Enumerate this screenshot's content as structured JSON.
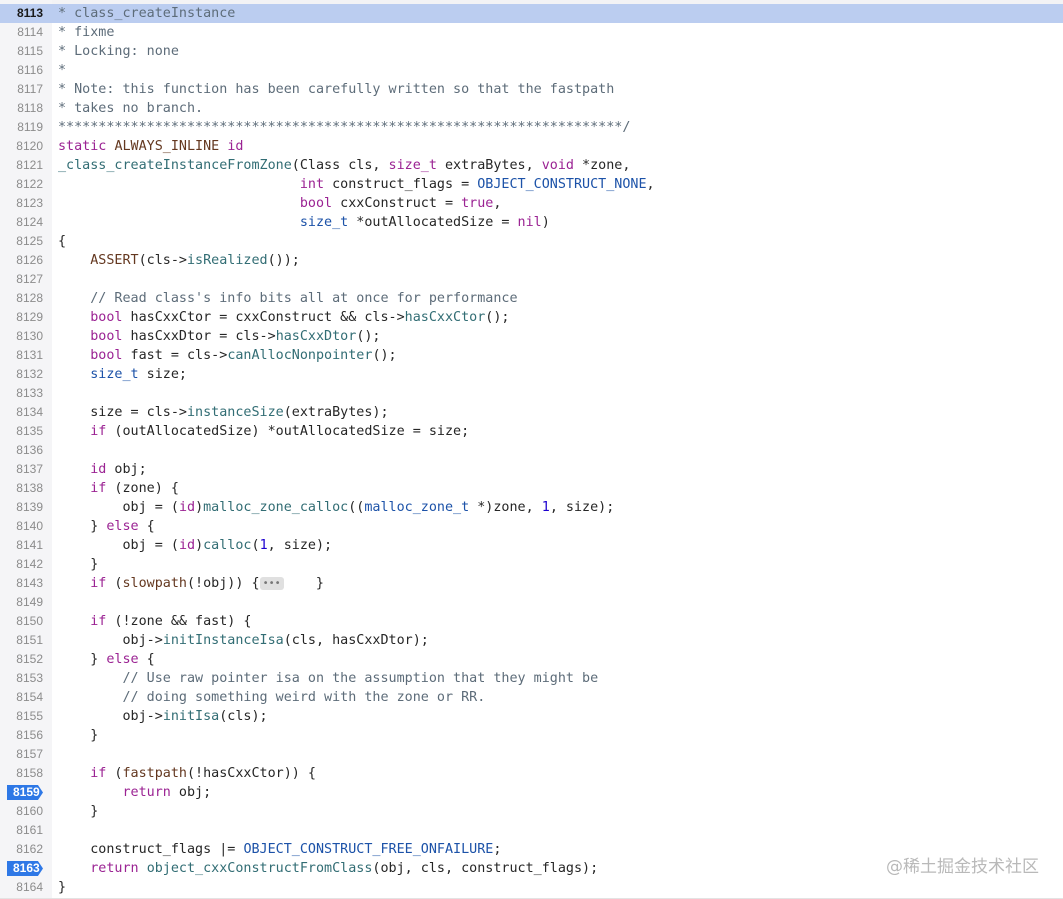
{
  "editor": {
    "current_line": "8113",
    "breakpoints": [
      "8159",
      "8163"
    ],
    "lines": [
      {
        "n": "8113",
        "t": [
          [
            "c",
            "* class_createInstance"
          ]
        ]
      },
      {
        "n": "8114",
        "t": [
          [
            "c",
            "* fixme"
          ]
        ]
      },
      {
        "n": "8115",
        "t": [
          [
            "c",
            "* Locking: none"
          ]
        ]
      },
      {
        "n": "8116",
        "t": [
          [
            "c",
            "*"
          ]
        ]
      },
      {
        "n": "8117",
        "t": [
          [
            "c",
            "* Note: this function has been carefully written so that the fastpath"
          ]
        ]
      },
      {
        "n": "8118",
        "t": [
          [
            "c",
            "* takes no branch."
          ]
        ]
      },
      {
        "n": "8119",
        "t": [
          [
            "c",
            "**********************************************************************/"
          ]
        ]
      },
      {
        "n": "8120",
        "t": [
          [
            "k",
            "static"
          ],
          [
            "p",
            " "
          ],
          [
            "m",
            "ALWAYS_INLINE"
          ],
          [
            "p",
            " "
          ],
          [
            "k",
            "id"
          ]
        ]
      },
      {
        "n": "8121",
        "t": [
          [
            "f",
            "_class_createInstanceFromZone"
          ],
          [
            "p",
            "(Class cls, "
          ],
          [
            "k",
            "size_t"
          ],
          [
            "p",
            " extraBytes, "
          ],
          [
            "k",
            "void"
          ],
          [
            "p",
            " *zone,"
          ]
        ]
      },
      {
        "n": "8122",
        "t": [
          [
            "p",
            "                              "
          ],
          [
            "k",
            "int"
          ],
          [
            "p",
            " construct_flags = "
          ],
          [
            "n",
            "OBJECT_CONSTRUCT_NONE"
          ],
          [
            "p",
            ","
          ]
        ]
      },
      {
        "n": "8123",
        "t": [
          [
            "p",
            "                              "
          ],
          [
            "k",
            "bool"
          ],
          [
            "p",
            " cxxConstruct = "
          ],
          [
            "k",
            "true"
          ],
          [
            "p",
            ","
          ]
        ]
      },
      {
        "n": "8124",
        "t": [
          [
            "p",
            "                              "
          ],
          [
            "y",
            "size_t"
          ],
          [
            "p",
            " *outAllocatedSize = "
          ],
          [
            "k",
            "nil"
          ],
          [
            "p",
            ")"
          ]
        ]
      },
      {
        "n": "8125",
        "t": [
          [
            "p",
            "{"
          ]
        ]
      },
      {
        "n": "8126",
        "t": [
          [
            "p",
            "    "
          ],
          [
            "m",
            "ASSERT"
          ],
          [
            "p",
            "(cls->"
          ],
          [
            "f",
            "isRealized"
          ],
          [
            "p",
            "());"
          ]
        ]
      },
      {
        "n": "8127",
        "t": []
      },
      {
        "n": "8128",
        "t": [
          [
            "p",
            "    "
          ],
          [
            "c",
            "// Read class's info bits all at once for performance"
          ]
        ]
      },
      {
        "n": "8129",
        "t": [
          [
            "p",
            "    "
          ],
          [
            "k",
            "bool"
          ],
          [
            "p",
            " hasCxxCtor = cxxConstruct && cls->"
          ],
          [
            "f",
            "hasCxxCtor"
          ],
          [
            "p",
            "();"
          ]
        ]
      },
      {
        "n": "8130",
        "t": [
          [
            "p",
            "    "
          ],
          [
            "k",
            "bool"
          ],
          [
            "p",
            " hasCxxDtor = cls->"
          ],
          [
            "f",
            "hasCxxDtor"
          ],
          [
            "p",
            "();"
          ]
        ]
      },
      {
        "n": "8131",
        "t": [
          [
            "p",
            "    "
          ],
          [
            "k",
            "bool"
          ],
          [
            "p",
            " fast = cls->"
          ],
          [
            "f",
            "canAllocNonpointer"
          ],
          [
            "p",
            "();"
          ]
        ]
      },
      {
        "n": "8132",
        "t": [
          [
            "p",
            "    "
          ],
          [
            "y",
            "size_t"
          ],
          [
            "p",
            " size;"
          ]
        ]
      },
      {
        "n": "8133",
        "t": []
      },
      {
        "n": "8134",
        "t": [
          [
            "p",
            "    size = cls->"
          ],
          [
            "f",
            "instanceSize"
          ],
          [
            "p",
            "(extraBytes);"
          ]
        ]
      },
      {
        "n": "8135",
        "t": [
          [
            "p",
            "    "
          ],
          [
            "k",
            "if"
          ],
          [
            "p",
            " (outAllocatedSize) *outAllocatedSize = size;"
          ]
        ]
      },
      {
        "n": "8136",
        "t": []
      },
      {
        "n": "8137",
        "t": [
          [
            "p",
            "    "
          ],
          [
            "k",
            "id"
          ],
          [
            "p",
            " obj;"
          ]
        ]
      },
      {
        "n": "8138",
        "t": [
          [
            "p",
            "    "
          ],
          [
            "k",
            "if"
          ],
          [
            "p",
            " (zone) {"
          ]
        ]
      },
      {
        "n": "8139",
        "t": [
          [
            "p",
            "        obj = ("
          ],
          [
            "k",
            "id"
          ],
          [
            "p",
            ")"
          ],
          [
            "f",
            "malloc_zone_calloc"
          ],
          [
            "p",
            "(("
          ],
          [
            "y",
            "malloc_zone_t"
          ],
          [
            "p",
            " *)zone, "
          ],
          [
            "u",
            "1"
          ],
          [
            "p",
            ", size);"
          ]
        ]
      },
      {
        "n": "8140",
        "t": [
          [
            "p",
            "    } "
          ],
          [
            "k",
            "else"
          ],
          [
            "p",
            " {"
          ]
        ]
      },
      {
        "n": "8141",
        "t": [
          [
            "p",
            "        obj = ("
          ],
          [
            "k",
            "id"
          ],
          [
            "p",
            ")"
          ],
          [
            "f",
            "calloc"
          ],
          [
            "p",
            "("
          ],
          [
            "u",
            "1"
          ],
          [
            "p",
            ", size);"
          ]
        ]
      },
      {
        "n": "8142",
        "t": [
          [
            "p",
            "    }"
          ]
        ]
      },
      {
        "n": "8143",
        "t": [
          [
            "p",
            "    "
          ],
          [
            "k",
            "if"
          ],
          [
            "p",
            " ("
          ],
          [
            "m",
            "slowpath"
          ],
          [
            "p",
            "(!obj)) {"
          ],
          [
            "fold",
            "•••"
          ],
          [
            "p",
            "    }"
          ]
        ]
      },
      {
        "n": "8149",
        "t": []
      },
      {
        "n": "8150",
        "t": [
          [
            "p",
            "    "
          ],
          [
            "k",
            "if"
          ],
          [
            "p",
            " (!zone && fast) {"
          ]
        ]
      },
      {
        "n": "8151",
        "t": [
          [
            "p",
            "        obj->"
          ],
          [
            "f",
            "initInstanceIsa"
          ],
          [
            "p",
            "(cls, hasCxxDtor);"
          ]
        ]
      },
      {
        "n": "8152",
        "t": [
          [
            "p",
            "    } "
          ],
          [
            "k",
            "else"
          ],
          [
            "p",
            " {"
          ]
        ]
      },
      {
        "n": "8153",
        "t": [
          [
            "p",
            "        "
          ],
          [
            "c",
            "// Use raw pointer isa on the assumption that they might be"
          ]
        ]
      },
      {
        "n": "8154",
        "t": [
          [
            "p",
            "        "
          ],
          [
            "c",
            "// doing something weird with the zone or RR."
          ]
        ]
      },
      {
        "n": "8155",
        "t": [
          [
            "p",
            "        obj->"
          ],
          [
            "f",
            "initIsa"
          ],
          [
            "p",
            "(cls);"
          ]
        ]
      },
      {
        "n": "8156",
        "t": [
          [
            "p",
            "    }"
          ]
        ]
      },
      {
        "n": "8157",
        "t": []
      },
      {
        "n": "8158",
        "t": [
          [
            "p",
            "    "
          ],
          [
            "k",
            "if"
          ],
          [
            "p",
            " ("
          ],
          [
            "m",
            "fastpath"
          ],
          [
            "p",
            "(!hasCxxCtor)) {"
          ]
        ]
      },
      {
        "n": "8159",
        "t": [
          [
            "p",
            "        "
          ],
          [
            "k",
            "return"
          ],
          [
            "p",
            " obj;"
          ]
        ]
      },
      {
        "n": "8160",
        "t": [
          [
            "p",
            "    }"
          ]
        ]
      },
      {
        "n": "8161",
        "t": []
      },
      {
        "n": "8162",
        "t": [
          [
            "p",
            "    construct_flags |= "
          ],
          [
            "n",
            "OBJECT_CONSTRUCT_FREE_ONFAILURE"
          ],
          [
            "p",
            ";"
          ]
        ]
      },
      {
        "n": "8163",
        "t": [
          [
            "p",
            "    "
          ],
          [
            "k",
            "return"
          ],
          [
            "p",
            " "
          ],
          [
            "f",
            "object_cxxConstructFromClass"
          ],
          [
            "p",
            "(obj, cls, construct_flags);"
          ]
        ]
      },
      {
        "n": "8164",
        "t": [
          [
            "p",
            "}"
          ]
        ]
      }
    ]
  },
  "watermark": "@稀土掘金技术社区",
  "colors": {
    "current_line_bg": "#bbcdf0",
    "breakpoint": "#2e78e6",
    "keyword": "#9b2393",
    "function": "#326d74",
    "comment": "#5d6c79",
    "type": "#1c52a8",
    "number": "#1c00cf",
    "macro": "#643820"
  },
  "icons": {
    "fold_ellipsis": "fold-ellipsis-icon",
    "breakpoint": "breakpoint-marker-icon"
  }
}
